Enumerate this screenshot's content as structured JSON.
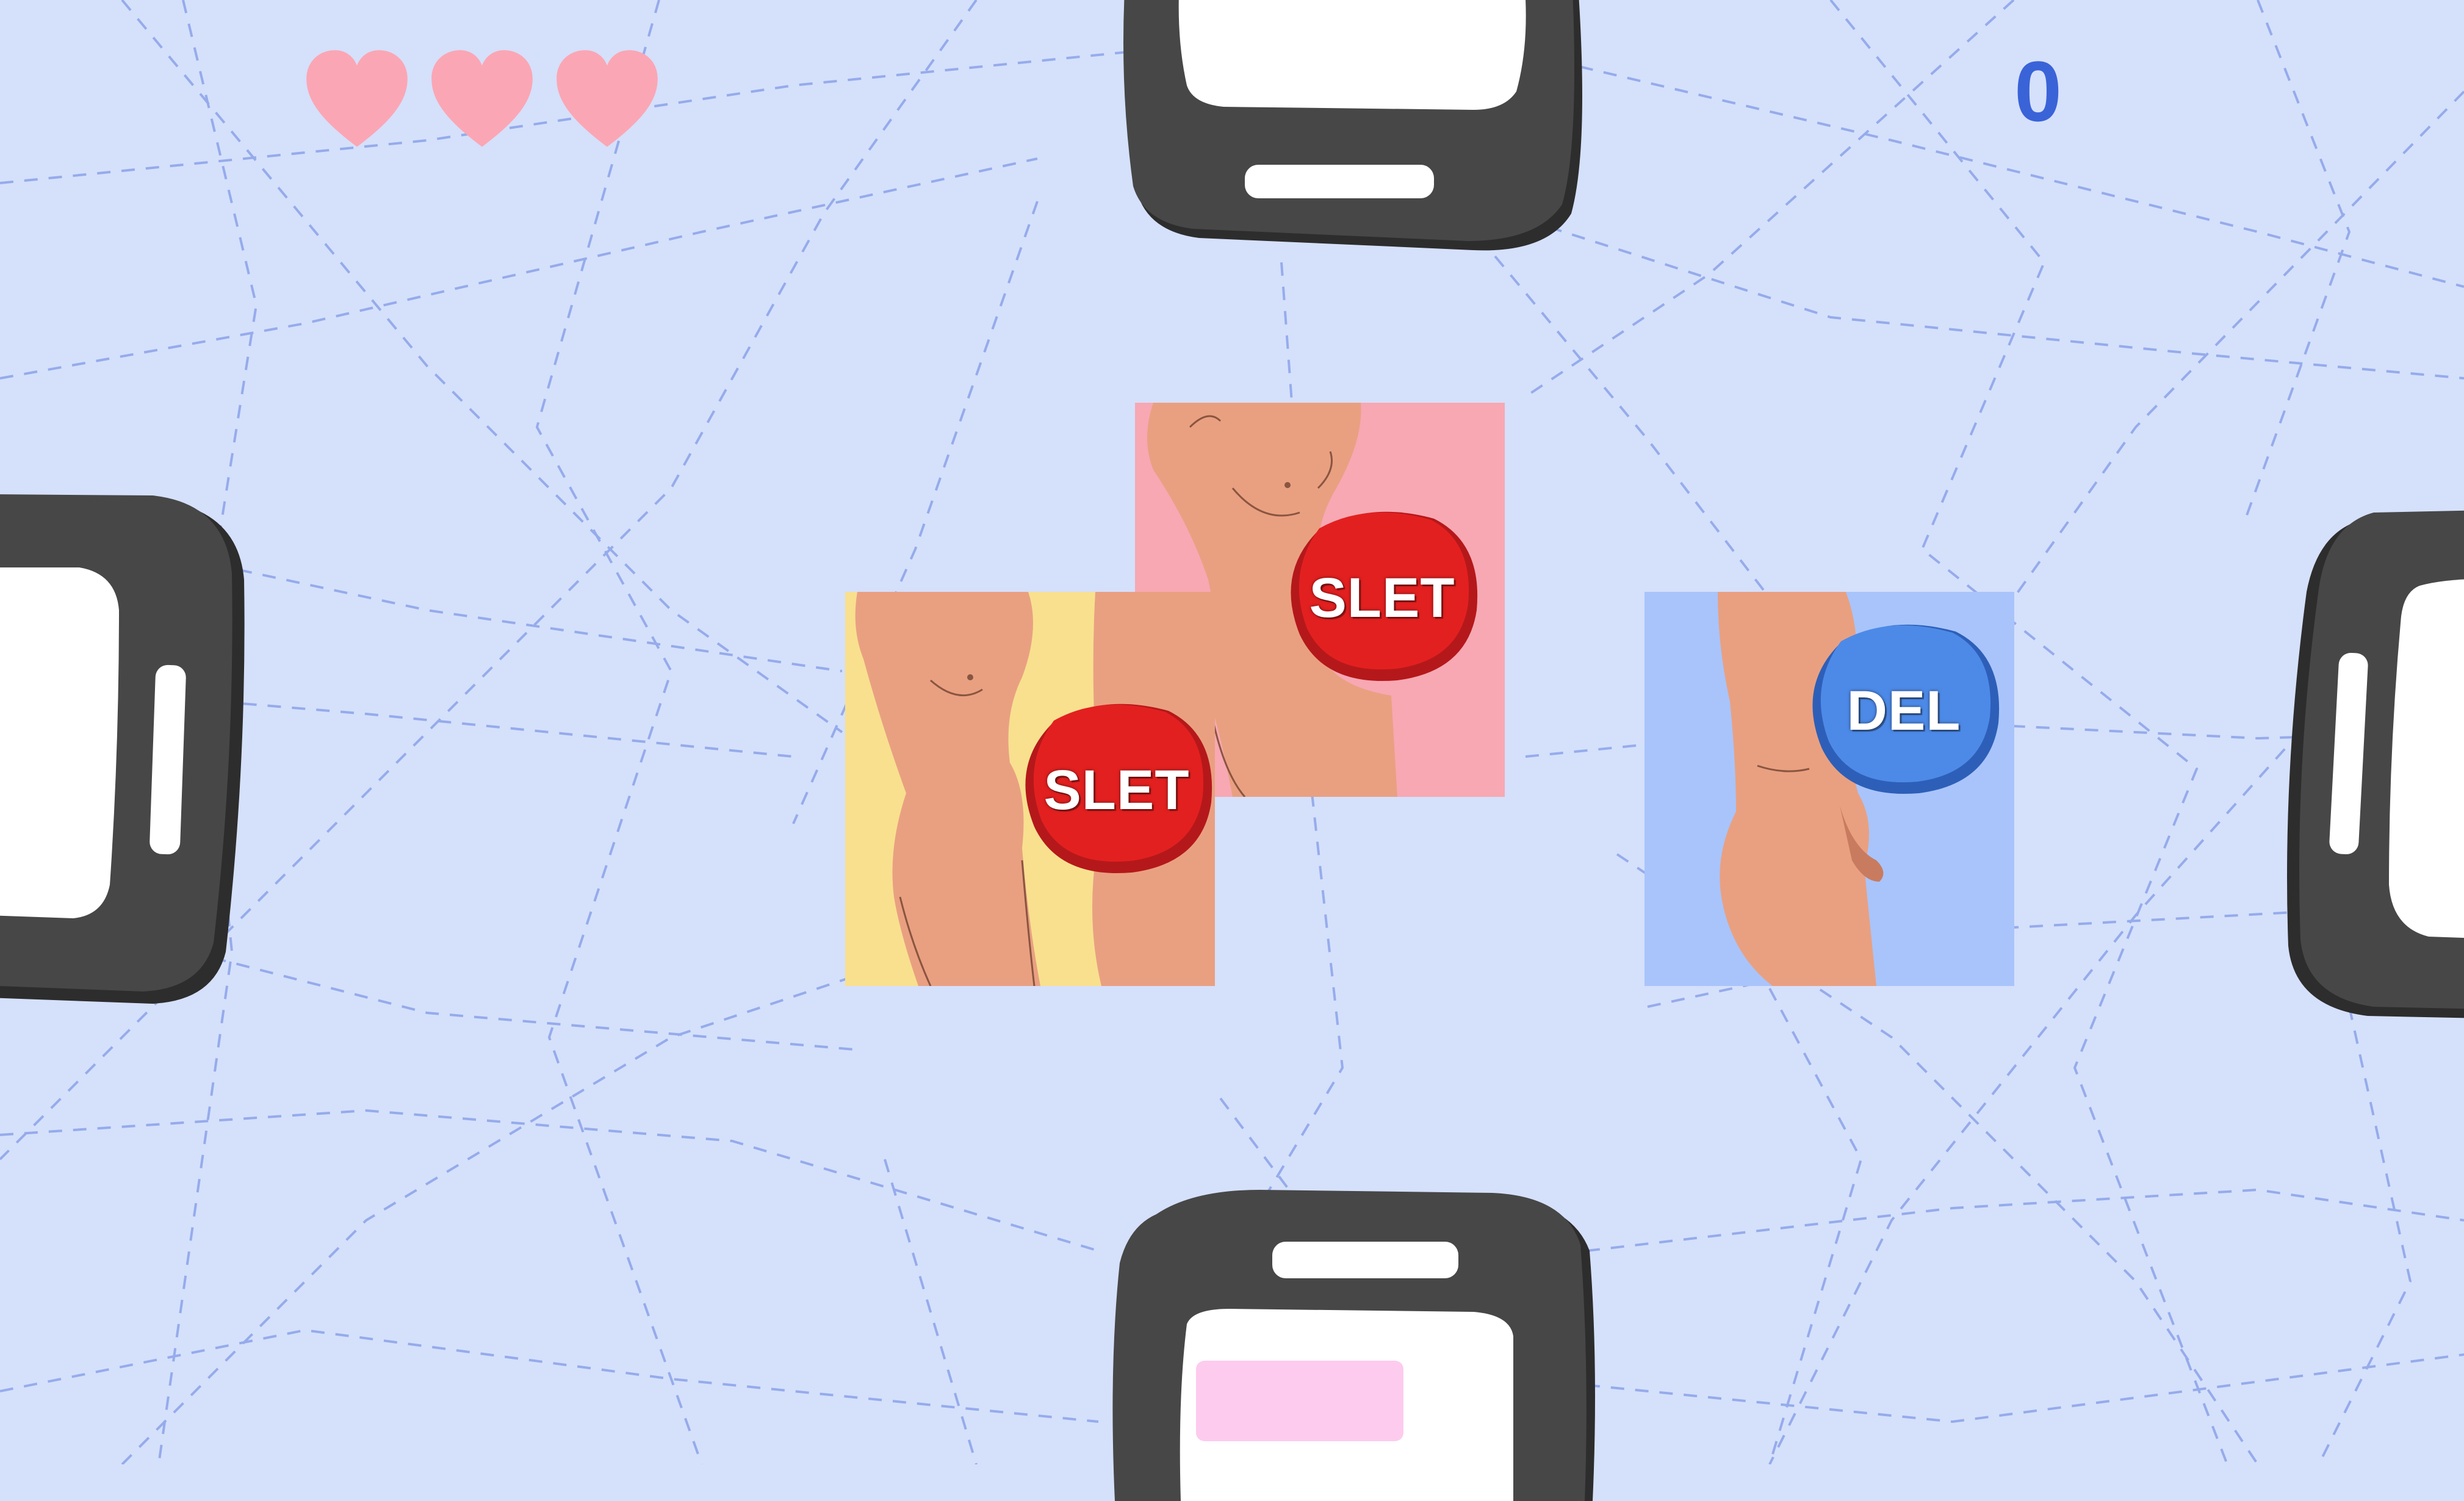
{
  "game": {
    "lives": 3,
    "score": "0"
  },
  "cards": [
    {
      "id": "pink",
      "label": "SLET",
      "background": "#f7a8b3",
      "badge_color": "#e32020"
    },
    {
      "id": "yellow",
      "label": "SLET",
      "background": "#f8e08f",
      "badge_color": "#e32020"
    },
    {
      "id": "blue",
      "label": "DEL",
      "background": "#a8c4fb",
      "badge_color": "#4d8ae8"
    }
  ],
  "colors": {
    "background": "#d5e0fb",
    "heart": "#fba6b4",
    "score": "#3a63d8",
    "phone_body": "#474747",
    "phone_screen": "#ffffff",
    "bottom_phone_message": "#fdcbee"
  },
  "icons": [
    "heart-icon",
    "smartphone-icon"
  ]
}
